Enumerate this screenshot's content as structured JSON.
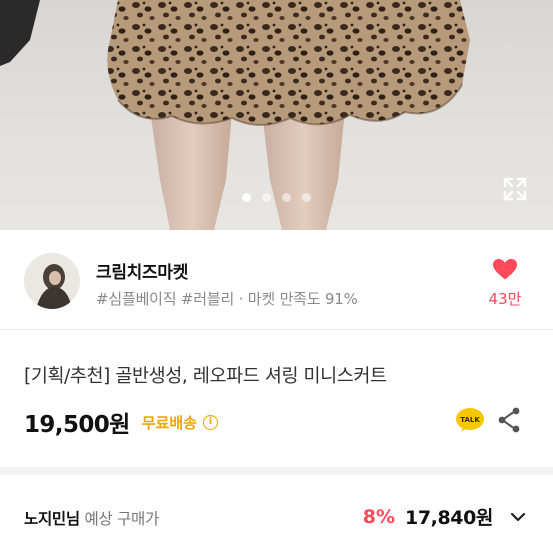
{
  "gallery": {
    "dots": [
      true,
      false,
      false,
      false
    ]
  },
  "seller": {
    "name": "크림치즈마켓",
    "tags": "#심플베이직 #러블리 · 마켓 만족도 91%",
    "likes": "43만"
  },
  "product": {
    "title": "[기획/추천] 골반생성, 레오파드 셔링 미니스커트",
    "price": "19,500원",
    "shipping": "무료배송"
  },
  "member": {
    "label_bold": "노지민님",
    "label_rest": " 예상 구매가",
    "discount": "8%",
    "price": "17,840원"
  },
  "colors": {
    "accent_red": "#ff4a5a",
    "shipping_orange": "#f0a500",
    "talk_yellow": "#f6c600"
  }
}
